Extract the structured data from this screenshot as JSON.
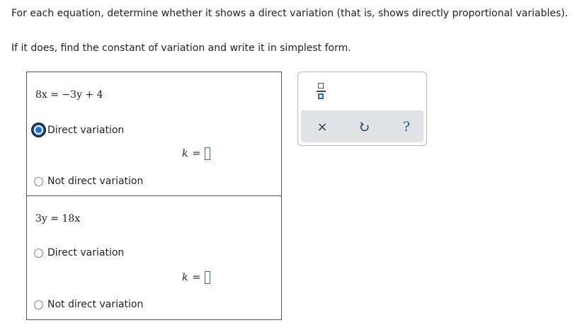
{
  "instructions": {
    "line1": "For each equation, determine whether it shows a direct variation (that is, shows directly proportional variables).",
    "line2": "If it does, find the constant of variation and write it in simplest form."
  },
  "problems": [
    {
      "equation": "8x  =  −3y + 4",
      "options": {
        "direct": "Direct variation",
        "not_direct": "Not direct variation"
      },
      "selected": "direct",
      "k_label": "k",
      "k_equals": "=",
      "k_value": ""
    },
    {
      "equation": "3y  =  18x",
      "options": {
        "direct": "Direct variation",
        "not_direct": "Not direct variation"
      },
      "selected": null,
      "k_label": "k",
      "k_equals": "=",
      "k_value": ""
    }
  ],
  "palette": {
    "fraction_icon": "fraction-icon",
    "clear_symbol": "×",
    "undo_icon": "undo-icon",
    "help_symbol": "?"
  },
  "colors": {
    "accent": "#1a6fd0",
    "input_border": "#2b6cb0",
    "palette_bar": "#dfe3e6"
  }
}
